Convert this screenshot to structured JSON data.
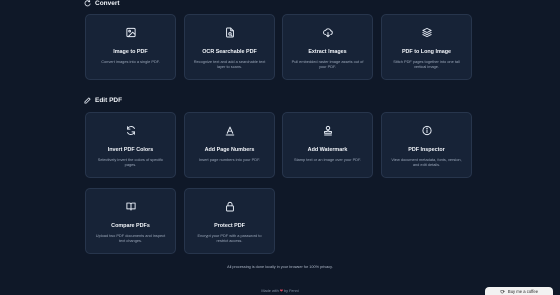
{
  "sections": {
    "convert": {
      "title": "Convert"
    },
    "edit": {
      "title": "Edit PDF"
    }
  },
  "convert_cards": [
    {
      "title": "Image to PDF",
      "desc": "Convert images into a single PDF.",
      "icon": "image-icon"
    },
    {
      "title": "OCR Searchable PDF",
      "desc": "Recognize text and add a searchable text layer to scans.",
      "icon": "file-search-icon"
    },
    {
      "title": "Extract Images",
      "desc": "Pull embedded raster image assets out of your PDF.",
      "icon": "cloud-download-icon"
    },
    {
      "title": "PDF to Long Image",
      "desc": "Stitch PDF pages together into one tall vertical image.",
      "icon": "layers-icon"
    }
  ],
  "edit_cards": [
    {
      "title": "Invert PDF Colors",
      "desc": "Selectively invert the colors of specific pages.",
      "icon": "refresh-icon"
    },
    {
      "title": "Add Page Numbers",
      "desc": "Insert page numbers into your PDF.",
      "icon": "letter-a-icon"
    },
    {
      "title": "Add Watermark",
      "desc": "Stamp text or an image over your PDF.",
      "icon": "stamp-icon"
    },
    {
      "title": "PDF Inspector",
      "desc": "View document metadata, fonts, version, and edit details.",
      "icon": "info-icon"
    },
    {
      "title": "Compare PDFs",
      "desc": "Upload two PDF documents and inspect text changes.",
      "icon": "book-open-icon"
    },
    {
      "title": "Protect PDF",
      "desc": "Encrypt your PDF with a password to restrict access.",
      "icon": "lock-icon"
    }
  ],
  "footer": {
    "privacy": "All processing is done locally in your browser for 100% privacy.",
    "made_with_prefix": "Made with",
    "heart": "❤",
    "made_with_suffix": "by Fenni",
    "coffee_label": "Buy me a coffee"
  }
}
